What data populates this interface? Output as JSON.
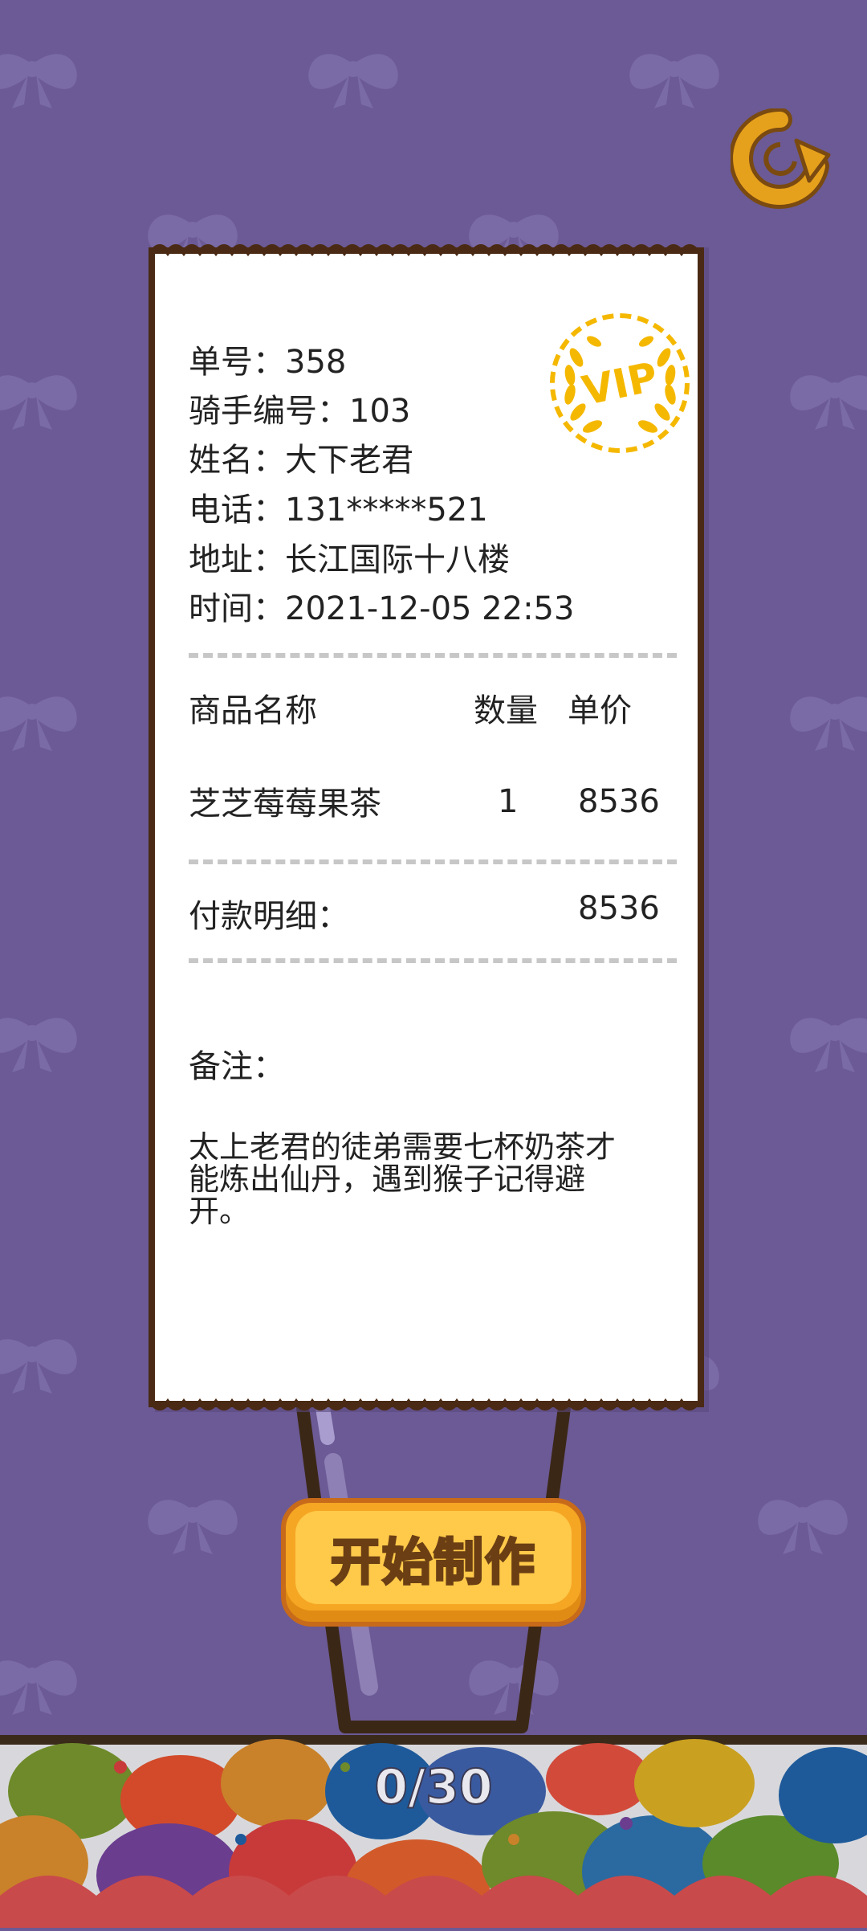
{
  "order": {
    "number_label": "单号：",
    "number": "358",
    "rider_label": "骑手编号：",
    "rider": "103",
    "name_label": "姓名：",
    "name": "大下老君",
    "phone_label": "电话：",
    "phone": "131*****521",
    "address_label": "地址：",
    "address": "长江国际十八楼",
    "time_label": "时间：",
    "time": "2021-12-05 22:53"
  },
  "vip_badge": "VIP",
  "items_header": {
    "name": "商品名称",
    "qty": "数量",
    "price": "单价"
  },
  "items": [
    {
      "name": "芝芝莓莓果茶",
      "qty": "1",
      "price": "8536"
    }
  ],
  "payment": {
    "label": "付款明细：",
    "total": "8536"
  },
  "notes": {
    "label": "备注：",
    "line1": "太上老君的徒弟需要七杯奶茶才",
    "line2": "能炼出仙丹，遇到猴子记得避",
    "line3": "开。"
  },
  "start_button": "开始制作",
  "progress": "0/30",
  "colors": {
    "background": "#6b5a95",
    "button": "#ffc94a",
    "gold": "#f5b800"
  }
}
